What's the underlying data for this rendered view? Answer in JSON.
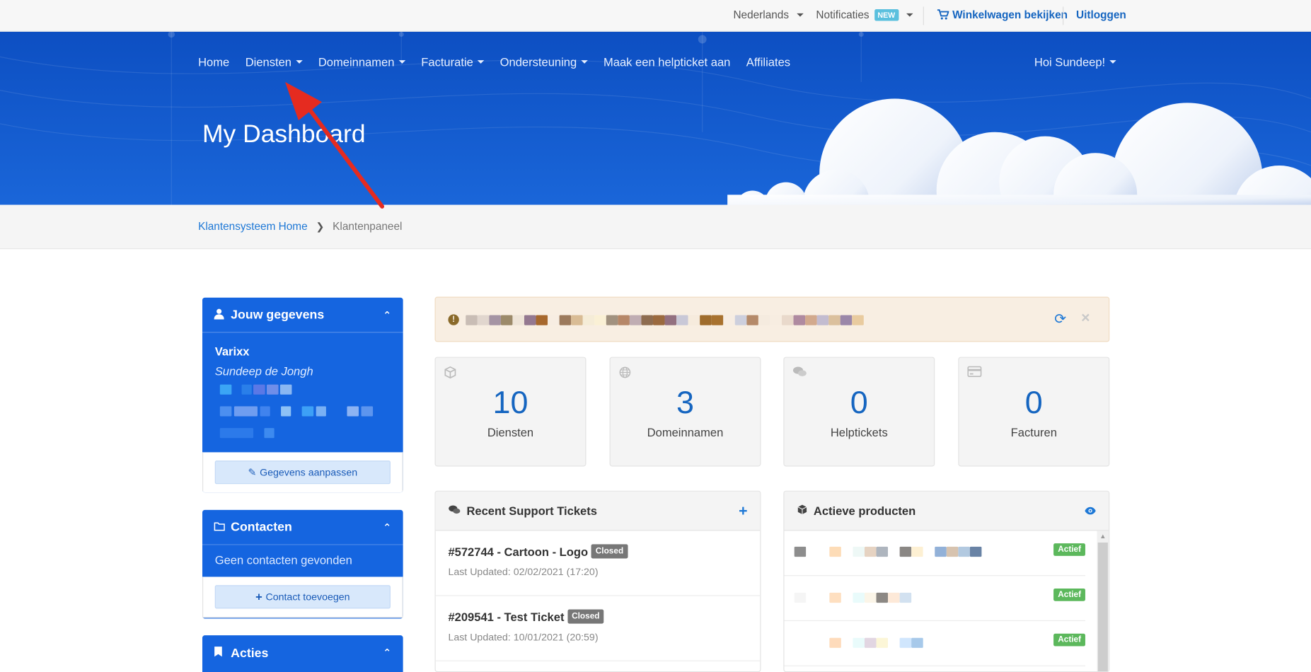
{
  "topbar": {
    "language": "Nederlands",
    "notifications": "Notificaties",
    "new_badge": "NEW",
    "cart": "Winkelwagen bekijken",
    "logout": "Uitloggen"
  },
  "nav": {
    "items": [
      {
        "label": "Home"
      },
      {
        "label": "Diensten"
      },
      {
        "label": "Domeinnamen"
      },
      {
        "label": "Facturatie"
      },
      {
        "label": "Ondersteuning"
      },
      {
        "label": "Maak een helpticket aan"
      },
      {
        "label": "Affiliates"
      }
    ],
    "greeting": "Hoi Sundeep!"
  },
  "hero": {
    "title": "My Dashboard"
  },
  "breadcrumb": {
    "home": "Klantensysteem Home",
    "current": "Klantenpaneel"
  },
  "sidebar": {
    "profile": {
      "title": "Jouw gegevens",
      "company": "Varixx",
      "name": "Sundeep de Jongh",
      "edit_button": "Gegevens aanpassen"
    },
    "contacts": {
      "title": "Contacten",
      "empty": "Geen contacten gevonden",
      "add_button": "Contact toevoegen"
    },
    "actions": {
      "title": "Acties"
    }
  },
  "stats": [
    {
      "value": "10",
      "label": "Diensten",
      "icon": "cube-icon"
    },
    {
      "value": "3",
      "label": "Domeinnamen",
      "icon": "globe-icon"
    },
    {
      "value": "0",
      "label": "Helptickets",
      "icon": "comments-icon"
    },
    {
      "value": "0",
      "label": "Facturen",
      "icon": "credit-card-icon"
    }
  ],
  "tickets": {
    "title": "Recent Support Tickets",
    "items": [
      {
        "title": "#572744 - Cartoon - Logo",
        "status": "Closed",
        "updated": "Last Updated: 02/02/2021 (17:20)"
      },
      {
        "title": "#209541 - Test Ticket",
        "status": "Closed",
        "updated": "Last Updated: 10/01/2021 (20:59)"
      }
    ]
  },
  "products": {
    "title": "Actieve producten",
    "items": [
      {
        "status": "Actief"
      },
      {
        "status": "Actief"
      },
      {
        "status": "Actief"
      }
    ]
  },
  "colors": {
    "brand_blue": "#1565e0",
    "link_blue": "#1e78d6",
    "success_green": "#5cb85c",
    "annotation_red": "#e52b20"
  }
}
